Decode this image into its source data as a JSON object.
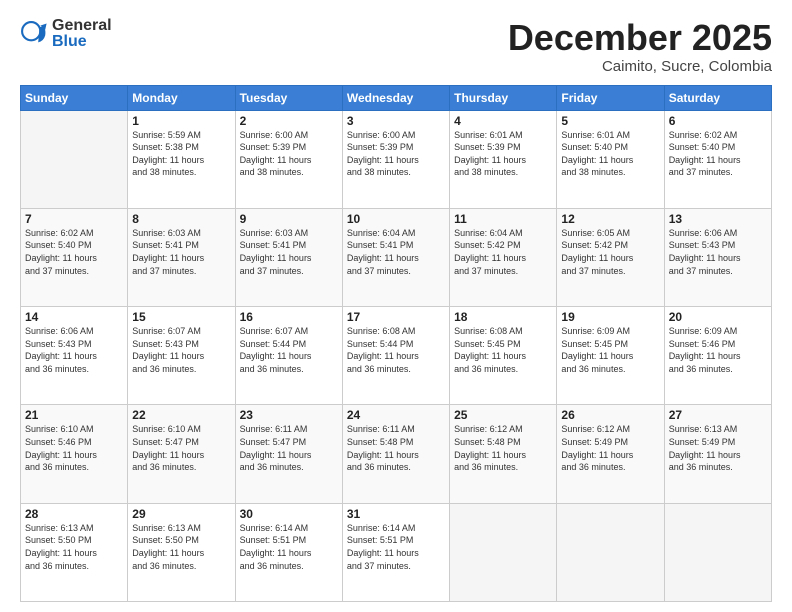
{
  "header": {
    "logo_general": "General",
    "logo_blue": "Blue",
    "month_title": "December 2025",
    "location": "Caimito, Sucre, Colombia"
  },
  "days_of_week": [
    "Sunday",
    "Monday",
    "Tuesday",
    "Wednesday",
    "Thursday",
    "Friday",
    "Saturday"
  ],
  "weeks": [
    [
      {
        "day": "",
        "info": ""
      },
      {
        "day": "1",
        "info": "Sunrise: 5:59 AM\nSunset: 5:38 PM\nDaylight: 11 hours\nand 38 minutes."
      },
      {
        "day": "2",
        "info": "Sunrise: 6:00 AM\nSunset: 5:39 PM\nDaylight: 11 hours\nand 38 minutes."
      },
      {
        "day": "3",
        "info": "Sunrise: 6:00 AM\nSunset: 5:39 PM\nDaylight: 11 hours\nand 38 minutes."
      },
      {
        "day": "4",
        "info": "Sunrise: 6:01 AM\nSunset: 5:39 PM\nDaylight: 11 hours\nand 38 minutes."
      },
      {
        "day": "5",
        "info": "Sunrise: 6:01 AM\nSunset: 5:40 PM\nDaylight: 11 hours\nand 38 minutes."
      },
      {
        "day": "6",
        "info": "Sunrise: 6:02 AM\nSunset: 5:40 PM\nDaylight: 11 hours\nand 37 minutes."
      }
    ],
    [
      {
        "day": "7",
        "info": "Sunrise: 6:02 AM\nSunset: 5:40 PM\nDaylight: 11 hours\nand 37 minutes."
      },
      {
        "day": "8",
        "info": "Sunrise: 6:03 AM\nSunset: 5:41 PM\nDaylight: 11 hours\nand 37 minutes."
      },
      {
        "day": "9",
        "info": "Sunrise: 6:03 AM\nSunset: 5:41 PM\nDaylight: 11 hours\nand 37 minutes."
      },
      {
        "day": "10",
        "info": "Sunrise: 6:04 AM\nSunset: 5:41 PM\nDaylight: 11 hours\nand 37 minutes."
      },
      {
        "day": "11",
        "info": "Sunrise: 6:04 AM\nSunset: 5:42 PM\nDaylight: 11 hours\nand 37 minutes."
      },
      {
        "day": "12",
        "info": "Sunrise: 6:05 AM\nSunset: 5:42 PM\nDaylight: 11 hours\nand 37 minutes."
      },
      {
        "day": "13",
        "info": "Sunrise: 6:06 AM\nSunset: 5:43 PM\nDaylight: 11 hours\nand 37 minutes."
      }
    ],
    [
      {
        "day": "14",
        "info": "Sunrise: 6:06 AM\nSunset: 5:43 PM\nDaylight: 11 hours\nand 36 minutes."
      },
      {
        "day": "15",
        "info": "Sunrise: 6:07 AM\nSunset: 5:43 PM\nDaylight: 11 hours\nand 36 minutes."
      },
      {
        "day": "16",
        "info": "Sunrise: 6:07 AM\nSunset: 5:44 PM\nDaylight: 11 hours\nand 36 minutes."
      },
      {
        "day": "17",
        "info": "Sunrise: 6:08 AM\nSunset: 5:44 PM\nDaylight: 11 hours\nand 36 minutes."
      },
      {
        "day": "18",
        "info": "Sunrise: 6:08 AM\nSunset: 5:45 PM\nDaylight: 11 hours\nand 36 minutes."
      },
      {
        "day": "19",
        "info": "Sunrise: 6:09 AM\nSunset: 5:45 PM\nDaylight: 11 hours\nand 36 minutes."
      },
      {
        "day": "20",
        "info": "Sunrise: 6:09 AM\nSunset: 5:46 PM\nDaylight: 11 hours\nand 36 minutes."
      }
    ],
    [
      {
        "day": "21",
        "info": "Sunrise: 6:10 AM\nSunset: 5:46 PM\nDaylight: 11 hours\nand 36 minutes."
      },
      {
        "day": "22",
        "info": "Sunrise: 6:10 AM\nSunset: 5:47 PM\nDaylight: 11 hours\nand 36 minutes."
      },
      {
        "day": "23",
        "info": "Sunrise: 6:11 AM\nSunset: 5:47 PM\nDaylight: 11 hours\nand 36 minutes."
      },
      {
        "day": "24",
        "info": "Sunrise: 6:11 AM\nSunset: 5:48 PM\nDaylight: 11 hours\nand 36 minutes."
      },
      {
        "day": "25",
        "info": "Sunrise: 6:12 AM\nSunset: 5:48 PM\nDaylight: 11 hours\nand 36 minutes."
      },
      {
        "day": "26",
        "info": "Sunrise: 6:12 AM\nSunset: 5:49 PM\nDaylight: 11 hours\nand 36 minutes."
      },
      {
        "day": "27",
        "info": "Sunrise: 6:13 AM\nSunset: 5:49 PM\nDaylight: 11 hours\nand 36 minutes."
      }
    ],
    [
      {
        "day": "28",
        "info": "Sunrise: 6:13 AM\nSunset: 5:50 PM\nDaylight: 11 hours\nand 36 minutes."
      },
      {
        "day": "29",
        "info": "Sunrise: 6:13 AM\nSunset: 5:50 PM\nDaylight: 11 hours\nand 36 minutes."
      },
      {
        "day": "30",
        "info": "Sunrise: 6:14 AM\nSunset: 5:51 PM\nDaylight: 11 hours\nand 36 minutes."
      },
      {
        "day": "31",
        "info": "Sunrise: 6:14 AM\nSunset: 5:51 PM\nDaylight: 11 hours\nand 37 minutes."
      },
      {
        "day": "",
        "info": ""
      },
      {
        "day": "",
        "info": ""
      },
      {
        "day": "",
        "info": ""
      }
    ]
  ]
}
